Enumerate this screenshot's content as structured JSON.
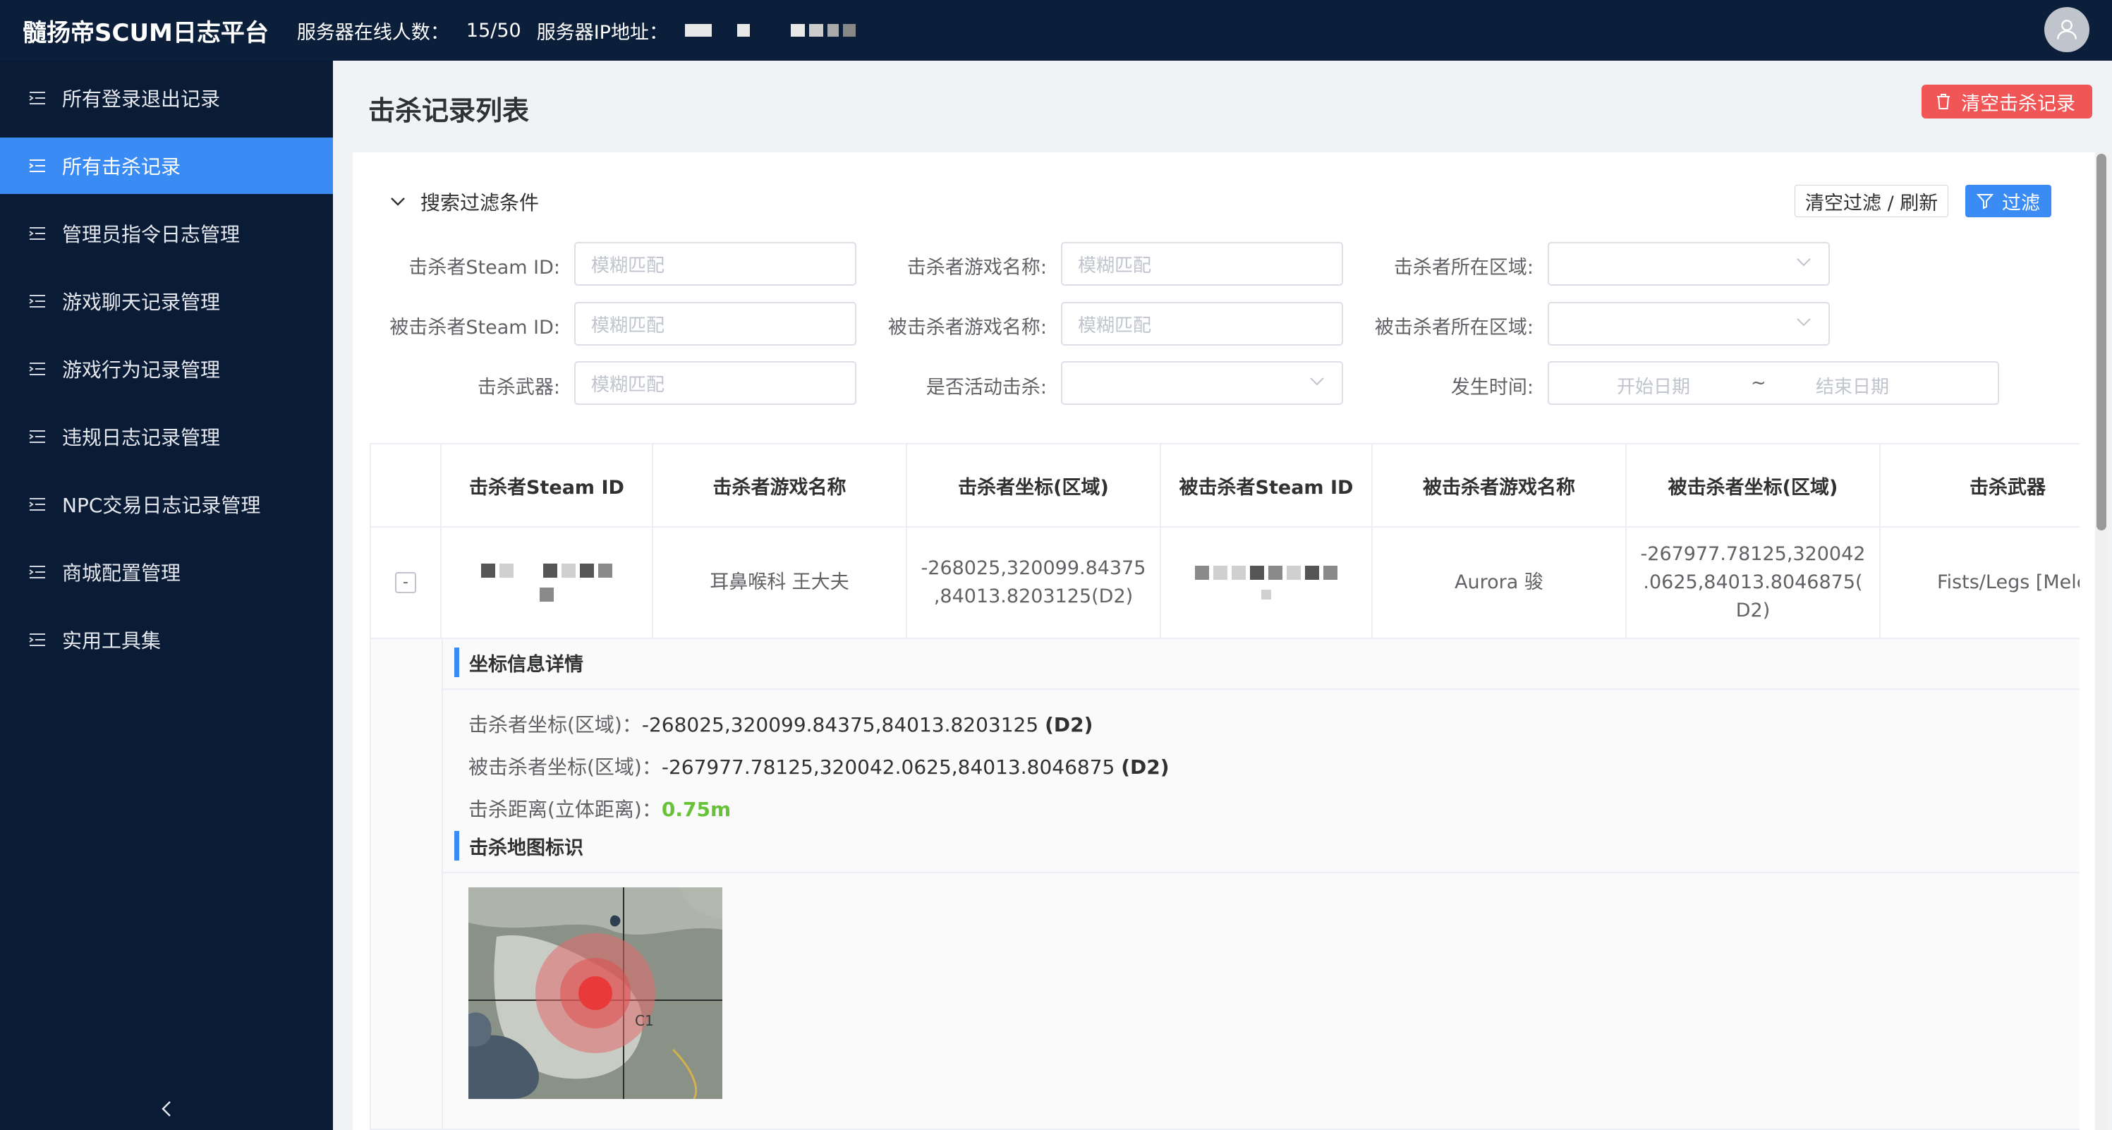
{
  "topbar": {
    "app_title": "髓扬帝SCUM日志平台",
    "online_label": "服务器在线人数：",
    "online_count": "15/50",
    "ip_label": "服务器IP地址："
  },
  "sidebar": {
    "items": [
      {
        "label": "所有登录退出记录",
        "active": false
      },
      {
        "label": "所有击杀记录",
        "active": true
      },
      {
        "label": "管理员指令日志管理",
        "active": false
      },
      {
        "label": "游戏聊天记录管理",
        "active": false
      },
      {
        "label": "游戏行为记录管理",
        "active": false
      },
      {
        "label": "违规日志记录管理",
        "active": false
      },
      {
        "label": "NPC交易日志记录管理",
        "active": false
      },
      {
        "label": "商城配置管理",
        "active": false
      },
      {
        "label": "实用工具集",
        "active": false
      }
    ]
  },
  "page": {
    "title": "击杀记录列表",
    "clear_button": "清空击杀记录"
  },
  "filter": {
    "header": "搜索过滤条件",
    "reset_button": "清空过滤 / 刷新",
    "filter_button": "过滤",
    "fields": {
      "killer_steam_id": {
        "label": "击杀者Steam ID:",
        "placeholder": "模糊匹配"
      },
      "killer_name": {
        "label": "击杀者游戏名称:",
        "placeholder": "模糊匹配"
      },
      "killer_area": {
        "label": "击杀者所在区域:"
      },
      "victim_steam_id": {
        "label": "被击杀者Steam ID:",
        "placeholder": "模糊匹配"
      },
      "victim_name": {
        "label": "被击杀者游戏名称:",
        "placeholder": "模糊匹配"
      },
      "victim_area": {
        "label": "被击杀者所在区域:"
      },
      "weapon": {
        "label": "击杀武器:",
        "placeholder": "模糊匹配"
      },
      "event_kill": {
        "label": "是否活动击杀:"
      },
      "time": {
        "label": "发生时间:",
        "start_placeholder": "开始日期",
        "separator": "~",
        "end_placeholder": "结束日期"
      }
    }
  },
  "table": {
    "columns": [
      "击杀者Steam ID",
      "击杀者游戏名称",
      "击杀者坐标(区域)",
      "被击杀者Steam ID",
      "被击杀者游戏名称",
      "被击杀者坐标(区域)",
      "击杀武器"
    ],
    "rows": [
      {
        "expand_symbol": "-",
        "killer_name": "耳鼻喉科 王大夫",
        "killer_coord_l1": "-268025,320099.84375",
        "killer_coord_l2": ",84013.8203125(D2)",
        "victim_name": "Aurora 骏",
        "victim_coord_l1": "-267977.78125,320042",
        "victim_coord_l2": ".0625,84013.8046875(",
        "victim_coord_l3": "D2)",
        "weapon": "Fists/Legs [Mele"
      }
    ]
  },
  "detail": {
    "coord_title": "坐标信息详情",
    "killer_coord_label": "击杀者坐标(区域)：",
    "killer_coord_value": "-268025,320099.84375,84013.8203125",
    "killer_area": "(D2)",
    "victim_coord_label": "被击杀者坐标(区域)：",
    "victim_coord_value": "-267977.78125,320042.0625,84013.8046875",
    "victim_area": "(D2)",
    "distance_label": "击杀距离(立体距离)：",
    "distance_value": "0.75m",
    "map_title": "击杀地图标识",
    "map_grid_label": "C1"
  }
}
